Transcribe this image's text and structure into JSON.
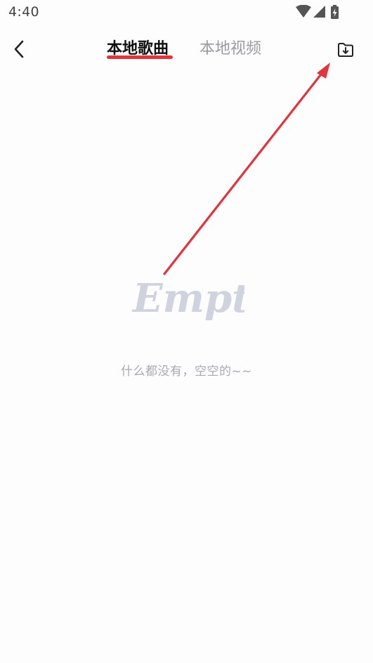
{
  "status_bar": {
    "time": "4:40",
    "icons": [
      "wifi-icon",
      "signal-icon",
      "battery-charging-icon"
    ]
  },
  "header": {
    "back_icon": "chevron-left-icon",
    "tabs": [
      {
        "label": "本地歌曲",
        "active": true
      },
      {
        "label": "本地视频",
        "active": false
      }
    ],
    "action_icon": "folder-download-icon"
  },
  "empty_state": {
    "illustration_text": "Empty",
    "message": "什么都没有，空空的~~"
  },
  "colors": {
    "accent": "#e2343a",
    "active_tab_text": "#111111",
    "inactive_tab_text": "#9a9aa2",
    "empty_text": "#a8a9b4",
    "illustration": "#cfd3dd",
    "background": "#fdfdfe"
  }
}
